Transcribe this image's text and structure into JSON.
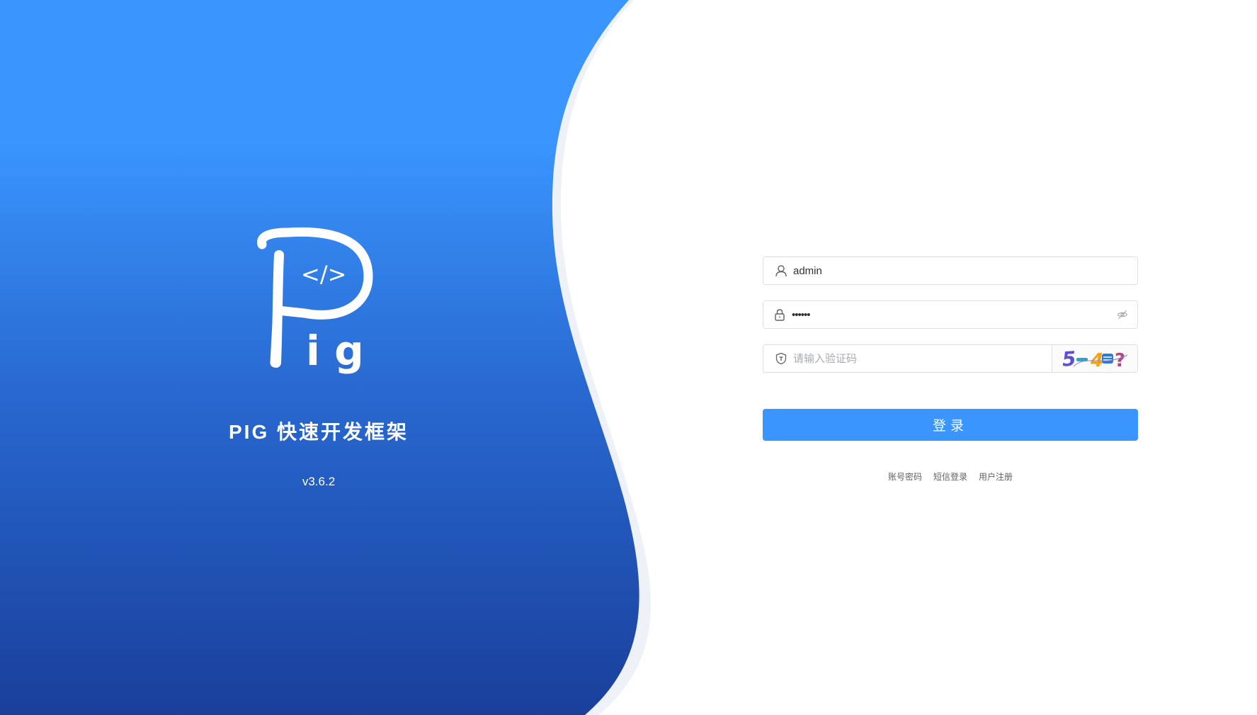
{
  "brand": {
    "title": "PIG 快速开发框架",
    "version": "v3.6.2",
    "logo_name": "pig-logo"
  },
  "form": {
    "username": {
      "value": "admin",
      "icon": "user-icon"
    },
    "password": {
      "value": "••••••",
      "icon": "lock-icon",
      "toggle_icon": "eye-off-icon"
    },
    "captcha": {
      "placeholder": "请输入验证码",
      "icon": "shield-icon",
      "image_text": "5-4=?"
    },
    "login_label": "登录"
  },
  "links": {
    "account": "账号密码",
    "sms": "短信登录",
    "register": "用户注册"
  },
  "colors": {
    "primary": "#3a95fe",
    "gradient_top": "#3a95fe",
    "gradient_bottom": "#1a3f9b",
    "wave_shadow": "#eef2f8"
  }
}
